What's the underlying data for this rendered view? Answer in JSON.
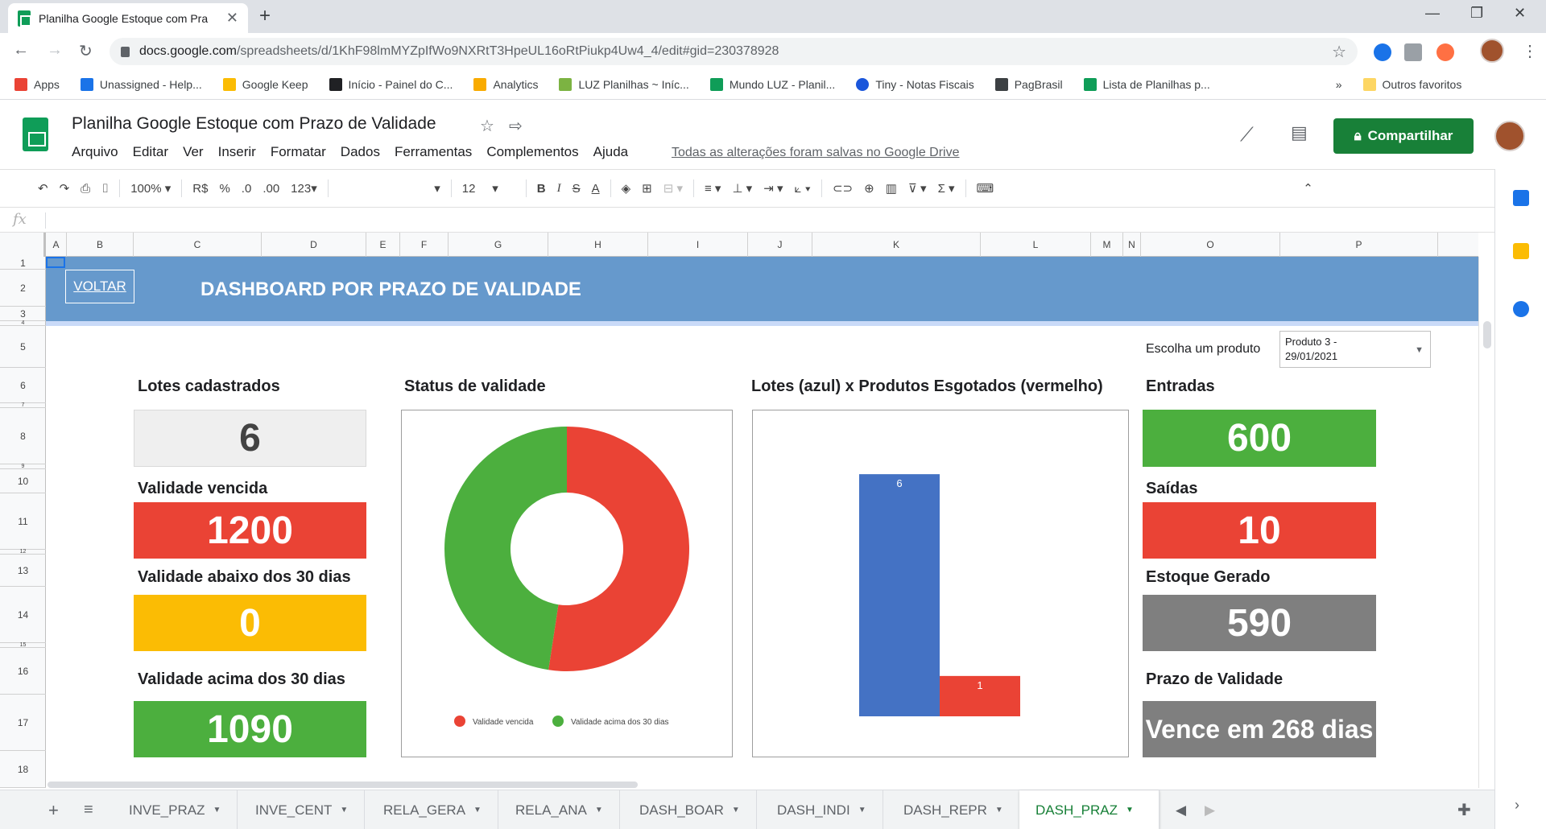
{
  "browser": {
    "tab_title": "Planilha Google Estoque com Pra",
    "url_domain": "docs.google.com",
    "url_path": "/spreadsheets/d/1KhF98lmMYZpIfWo9NXRtT3HpeUL16oRtPiukp4Uw4_4/edit#gid=230378928",
    "bookmarks": [
      {
        "label": "Apps",
        "color": "#ea4335"
      },
      {
        "label": "Unassigned - Help...",
        "color": "#1a73e8"
      },
      {
        "label": "Google Keep",
        "color": "#fbbc04"
      },
      {
        "label": "Início - Painel do C...",
        "color": "#202124"
      },
      {
        "label": "Analytics",
        "color": "#f9ab00"
      },
      {
        "label": "LUZ Planilhas ~ Iníc...",
        "color": "#7cb342"
      },
      {
        "label": "Mundo LUZ - Planil...",
        "color": "#0f9d58"
      },
      {
        "label": "Tiny - Notas Fiscais",
        "color": "#1a56db"
      },
      {
        "label": "PagBrasil",
        "color": "#3c4043"
      },
      {
        "label": "Lista de Planilhas p...",
        "color": "#0f9d58"
      }
    ],
    "bookmarks_more": "»",
    "other_bookmarks": "Outros favoritos"
  },
  "sheets": {
    "doc_title": "Planilha Google Estoque com Prazo de Validade",
    "menu": [
      "Arquivo",
      "Editar",
      "Ver",
      "Inserir",
      "Formatar",
      "Dados",
      "Ferramentas",
      "Complementos",
      "Ajuda"
    ],
    "saved_status": "Todas as alterações foram salvas no Google Drive",
    "share_label": "Compartilhar",
    "toolbar": {
      "zoom": "100%",
      "currency": "R$",
      "percent": "%",
      "dec_less": ".0",
      "dec_more": ".00",
      "format_more": "123",
      "font_size": "12",
      "bold": "B",
      "italic": "I",
      "strike": "S",
      "text_color": "A"
    },
    "fx": "fx",
    "columns": [
      "A",
      "B",
      "C",
      "D",
      "E",
      "F",
      "G",
      "H",
      "I",
      "J",
      "K",
      "L",
      "M",
      "N",
      "O",
      "P"
    ],
    "rows": [
      "1",
      "2",
      "3",
      "4",
      "5",
      "6",
      "7",
      "8",
      "9",
      "10",
      "11",
      "12",
      "13",
      "14",
      "15",
      "16",
      "17",
      "18"
    ],
    "sheet_tabs": [
      "INVE_PRAZ",
      "INVE_CENT",
      "RELA_GERA",
      "RELA_ANA",
      "DASH_BOAR",
      "DASH_INDI",
      "DASH_REPR",
      "DASH_PRAZ"
    ],
    "active_tab": "DASH_PRAZ"
  },
  "dashboard": {
    "back_button": "VOLTAR",
    "title": "DASHBOARD POR PRAZO DE VALIDADE",
    "product_label": "Escolha um produto",
    "product_value_line1": "Produto 3 -",
    "product_value_line2": "29/01/2021",
    "kpis": {
      "lotes_label": "Lotes cadastrados",
      "lotes_value": "6",
      "vencida_label": "Validade vencida",
      "vencida_value": "1200",
      "abaixo_label": "Validade abaixo dos 30 dias",
      "abaixo_value": "0",
      "acima_label": "Validade acima dos 30 dias",
      "acima_value": "1090",
      "entradas_label": "Entradas",
      "entradas_value": "600",
      "saidas_label": "Saídas",
      "saidas_value": "10",
      "estoque_label": "Estoque Gerado",
      "estoque_value": "590",
      "prazo_label": "Prazo de Validade",
      "prazo_value": "Vence em 268 dias"
    },
    "colors": {
      "banner": "#6699cc",
      "red": "#ea4335",
      "green": "#4caf3e",
      "yellow": "#fbbc04",
      "gray": "#7f7f7f",
      "light": "#efefef",
      "blue": "#4472c4"
    }
  },
  "chart_data": [
    {
      "type": "pie",
      "title": "Status de validade",
      "categories": [
        "Validade vencida",
        "Validade acima dos 30 dias"
      ],
      "values": [
        1200,
        1090
      ],
      "colors": [
        "#ea4335",
        "#4caf3e"
      ],
      "donut": true,
      "legend": "bottom"
    },
    {
      "type": "bar",
      "title": "Lotes (azul) x Produtos Esgotados (vermelho)",
      "categories": [
        "Lotes",
        "Produtos Esgotados"
      ],
      "values": [
        6,
        1
      ],
      "colors": [
        "#4472c4",
        "#ea4335"
      ],
      "data_labels": [
        "6",
        "1"
      ],
      "ylim": [
        0,
        7
      ],
      "legend": "none"
    }
  ]
}
